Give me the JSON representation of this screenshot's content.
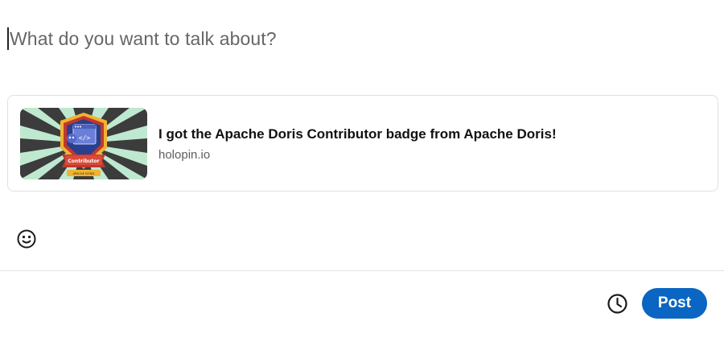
{
  "editor": {
    "placeholder": "What do you want to talk about?"
  },
  "link_preview": {
    "title": "I got the Apache Doris Contributor badge from Apache Doris!",
    "domain": "holopin.io",
    "thumbnail": {
      "badge_ribbon": "Contributor",
      "badge_caption": "APACHE DORIS",
      "colors": {
        "background": "#3c3c3c",
        "rays": "#bfe8d0",
        "shield": "#2a3f8f",
        "ribbon": "#c0392b",
        "gold": "#f2b233"
      }
    }
  },
  "toolbar": {
    "emoji_icon": "emoji-smiley-icon",
    "schedule_icon": "clock-icon",
    "post_label": "Post"
  },
  "colors": {
    "accent": "#0a66c2",
    "divider": "#e3e3e3"
  }
}
